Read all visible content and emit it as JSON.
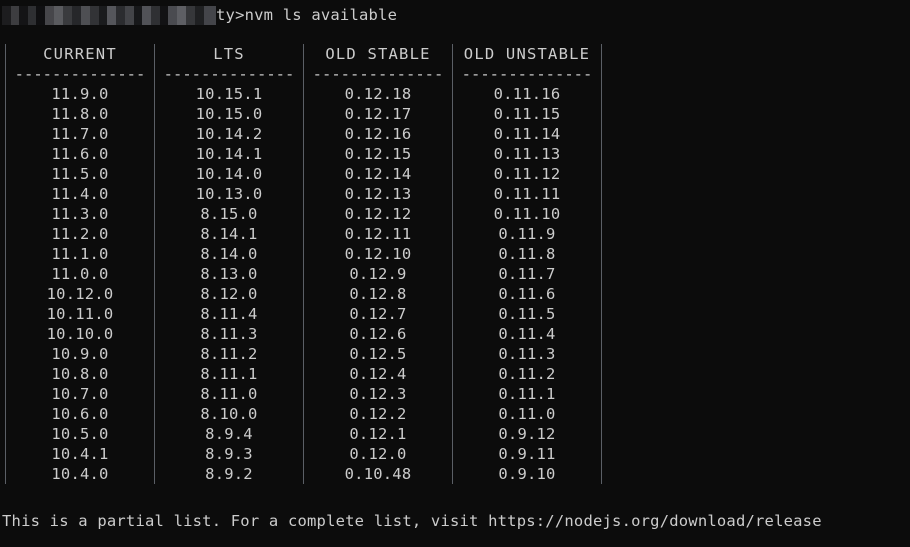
{
  "terminal": {
    "background_color": "#0c0c0c",
    "text_color": "#cccccc",
    "separator_color": "#5b5f66"
  },
  "prompt": {
    "redacted_path_placeholder": "",
    "visible_path_tail": "ty>",
    "command": "nvm ls available",
    "full_visible_line": "ty>nvm ls available"
  },
  "table": {
    "headers": [
      "CURRENT",
      "LTS",
      "OLD STABLE",
      "OLD UNSTABLE"
    ],
    "divider": "--------------",
    "rows": [
      [
        "11.9.0",
        "10.15.1",
        "0.12.18",
        "0.11.16"
      ],
      [
        "11.8.0",
        "10.15.0",
        "0.12.17",
        "0.11.15"
      ],
      [
        "11.7.0",
        "10.14.2",
        "0.12.16",
        "0.11.14"
      ],
      [
        "11.6.0",
        "10.14.1",
        "0.12.15",
        "0.11.13"
      ],
      [
        "11.5.0",
        "10.14.0",
        "0.12.14",
        "0.11.12"
      ],
      [
        "11.4.0",
        "10.13.0",
        "0.12.13",
        "0.11.11"
      ],
      [
        "11.3.0",
        "8.15.0",
        "0.12.12",
        "0.11.10"
      ],
      [
        "11.2.0",
        "8.14.1",
        "0.12.11",
        "0.11.9"
      ],
      [
        "11.1.0",
        "8.14.0",
        "0.12.10",
        "0.11.8"
      ],
      [
        "11.0.0",
        "8.13.0",
        "0.12.9",
        "0.11.7"
      ],
      [
        "10.12.0",
        "8.12.0",
        "0.12.8",
        "0.11.6"
      ],
      [
        "10.11.0",
        "8.11.4",
        "0.12.7",
        "0.11.5"
      ],
      [
        "10.10.0",
        "8.11.3",
        "0.12.6",
        "0.11.4"
      ],
      [
        "10.9.0",
        "8.11.2",
        "0.12.5",
        "0.11.3"
      ],
      [
        "10.8.0",
        "8.11.1",
        "0.12.4",
        "0.11.2"
      ],
      [
        "10.7.0",
        "8.11.0",
        "0.12.3",
        "0.11.1"
      ],
      [
        "10.6.0",
        "8.10.0",
        "0.12.2",
        "0.11.0"
      ],
      [
        "10.5.0",
        "8.9.4",
        "0.12.1",
        "0.9.12"
      ],
      [
        "10.4.1",
        "8.9.3",
        "0.12.0",
        "0.9.11"
      ],
      [
        "10.4.0",
        "8.9.2",
        "0.10.48",
        "0.9.10"
      ]
    ]
  },
  "footer": {
    "message": "This is a partial list. For a complete list, visit https://nodejs.org/download/release"
  }
}
